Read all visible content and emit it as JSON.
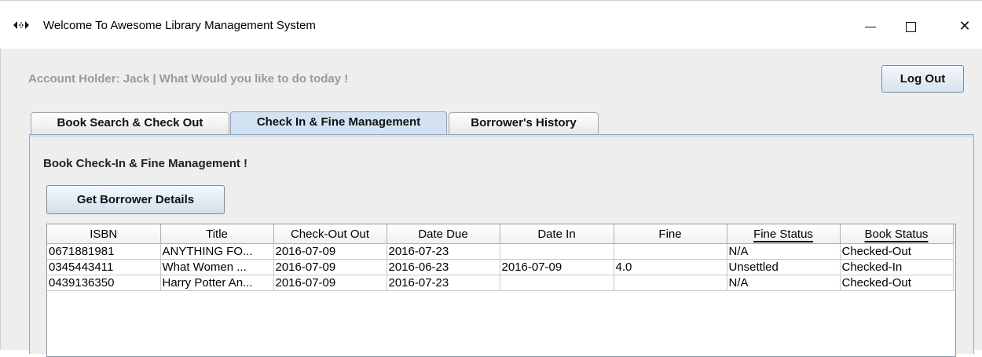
{
  "window": {
    "title": "Welcome To Awesome Library Management System",
    "icon": "app-icon",
    "controls": {
      "minimize_icon": "minimize-icon",
      "maximize_icon": "maximize-icon",
      "close_label": "✕"
    }
  },
  "header": {
    "account_label": "Account Holder: Jack | What Would you like to do today !",
    "logout_label": "Log Out"
  },
  "tabs": [
    {
      "label": "Book Search & Check Out",
      "selected": false
    },
    {
      "label": "Check In & Fine Management",
      "selected": true
    },
    {
      "label": "Borrower's History",
      "selected": false
    }
  ],
  "panel": {
    "title": "Book Check-In & Fine Management !",
    "get_details_label": "Get Borrower Details"
  },
  "table": {
    "columns": [
      "ISBN",
      "Title",
      "Check-Out Out",
      "Date Due",
      "Date In",
      "Fine",
      "Fine Status",
      "Book Status"
    ],
    "rows": [
      [
        "0671881981",
        "ANYTHING FO...",
        "2016-07-09",
        "2016-07-23",
        "",
        "",
        "N/A",
        "Checked-Out"
      ],
      [
        "0345443411",
        "What Women ...",
        "2016-07-09",
        "2016-06-23",
        "2016-07-09",
        "4.0",
        "Unsettled",
        "Checked-In"
      ],
      [
        "0439136350",
        "Harry Potter An...",
        "2016-07-09",
        "2016-07-23",
        "",
        "",
        "N/A",
        "Checked-Out"
      ]
    ]
  },
  "colors": {
    "selected_tab": "#d2e2f2",
    "client_bg": "#eeeeee",
    "account_text": "#9a9a9a"
  }
}
